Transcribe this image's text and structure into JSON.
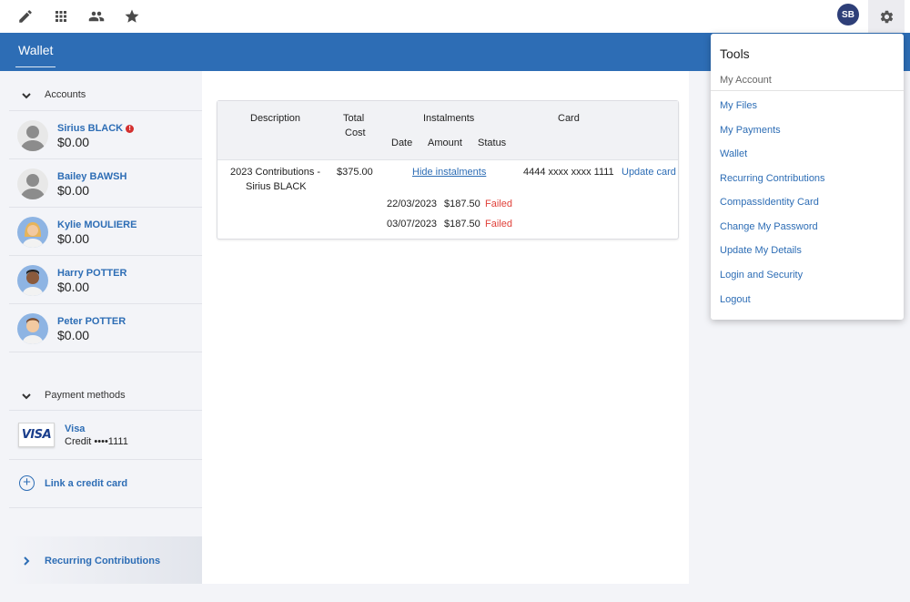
{
  "topbar": {
    "icons": [
      "pencil-icon",
      "apps-grid-icon",
      "people-icon",
      "star-icon",
      "gear-icon"
    ],
    "user_initials": "SB"
  },
  "header": {
    "tab_label": "Wallet"
  },
  "sidebar": {
    "accounts_label": "Accounts",
    "accounts": [
      {
        "name": "Sirius BLACK",
        "amount": "$0.00",
        "error": "!"
      },
      {
        "name": "Bailey BAWSH",
        "amount": "$0.00"
      },
      {
        "name": "Kylie MOULIERE",
        "amount": "$0.00"
      },
      {
        "name": "Harry POTTER",
        "amount": "$0.00"
      },
      {
        "name": "Peter POTTER",
        "amount": "$0.00"
      }
    ],
    "payment_methods_label": "Payment methods",
    "payment_method": {
      "logo": "VISA",
      "brand": "Visa",
      "detail": "Credit ••••1111"
    },
    "link_card_label": "Link a credit card",
    "recurring_label": "Recurring Contributions"
  },
  "table": {
    "headers": {
      "description": "Description",
      "total_cost_1": "Total",
      "total_cost_2": "Cost",
      "instalments": "Instalments",
      "date": "Date",
      "amount": "Amount",
      "status": "Status",
      "card": "Card"
    },
    "row": {
      "description_1": "2023 Contributions -",
      "description_2": "Sirius BLACK",
      "total_cost": "$375.00",
      "hide_link": "Hide instalments",
      "card": "4444 xxxx xxxx 1111",
      "update_card": "Update card"
    },
    "instalments": [
      {
        "date": "22/03/2023",
        "amount": "$187.50",
        "status": "Failed"
      },
      {
        "date": "03/07/2023",
        "amount": "$187.50",
        "status": "Failed"
      }
    ]
  },
  "tools_menu": {
    "title": "Tools",
    "subtitle": "My Account",
    "items": [
      "My Files",
      "My Payments",
      "Wallet",
      "Recurring Contributions",
      "CompassIdentity Card",
      "Change My Password",
      "Update My Details",
      "Login and Security",
      "Logout"
    ]
  },
  "colors": {
    "brand_blue": "#2d6db5",
    "failed_red": "#e0413a",
    "avatar_navy": "#2e3f78"
  }
}
